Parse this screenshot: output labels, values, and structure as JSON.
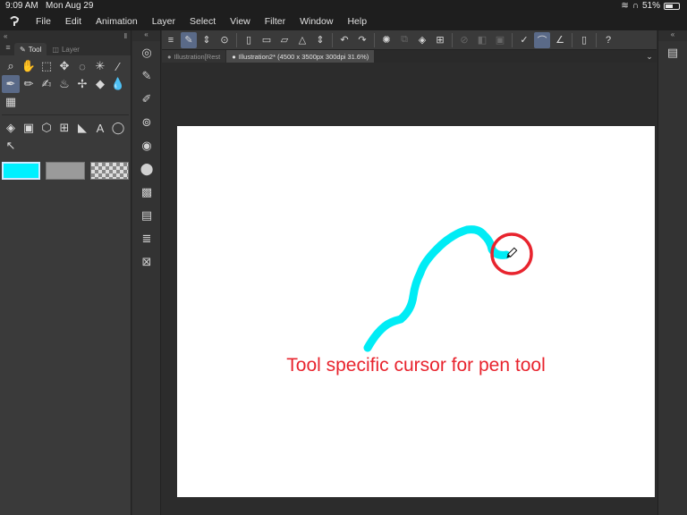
{
  "status_bar": {
    "time": "9:09 AM",
    "date": "Mon Aug 29",
    "battery": "51%"
  },
  "menu": {
    "items": [
      "File",
      "Edit",
      "Animation",
      "Layer",
      "Select",
      "View",
      "Filter",
      "Window",
      "Help"
    ]
  },
  "left_panel": {
    "tabs": [
      {
        "label": "Tool",
        "active": true
      },
      {
        "label": "Layer",
        "active": false
      }
    ],
    "tools": [
      "zoom-icon",
      "hand-icon",
      "lasso-select-icon",
      "move-icon",
      "lasso-icon",
      "magic-wand-icon",
      "eyedropper-icon",
      "pen-icon",
      "pencil-icon",
      "brush-icon",
      "airbrush-icon",
      "decoration-icon",
      "eraser-icon",
      "blend-icon",
      "grid-icon"
    ],
    "tools2": [
      "fill-icon",
      "gradient-icon",
      "polygon-icon",
      "frame-icon",
      "ruler-icon",
      "text-icon",
      "balloon-icon",
      "correct-line-icon"
    ],
    "colors": {
      "main": "#00f0ff",
      "sub": "#9a9a9a"
    }
  },
  "document_tabs": [
    {
      "label": "Illustration[Rest",
      "active": false
    },
    {
      "label": "Illustration2* (4500 x 3500px 300dpi 31.6%)",
      "active": true
    }
  ],
  "canvas": {
    "stroke_color": "#00ecf5",
    "highlight_color": "#e8242e",
    "annotation": "Tool specific cursor for pen tool"
  }
}
